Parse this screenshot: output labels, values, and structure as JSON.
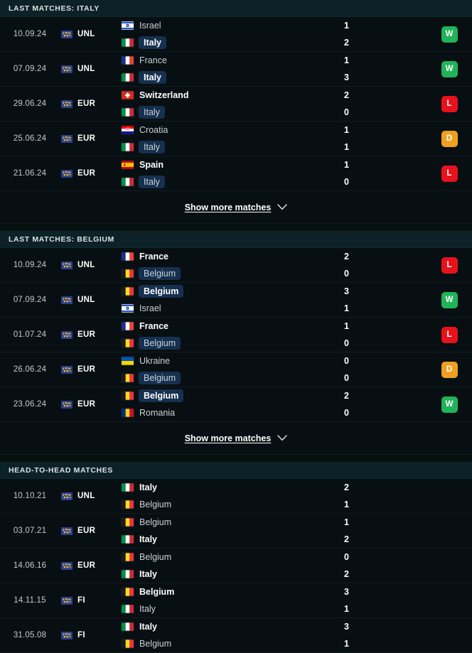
{
  "colors": {
    "page_bg": "#06100f",
    "row_bg": "#080f12",
    "section_header_bg": "#0c2226",
    "highlight_bg": "#16304f",
    "win": "#21b35a",
    "loss": "#e8121c",
    "draw": "#f0a01e",
    "comp_icon_bg": "#2b3f8f",
    "comp_icon_fg": "#e8bb3c"
  },
  "sections": [
    {
      "id": "last-matches-italy",
      "title": "LAST MATCHES: ITALY",
      "has_show_more": true,
      "show_more_label": "Show more matches",
      "show_more_icon": "chevron-down-icon",
      "has_result_badges": true,
      "matches": [
        {
          "date": "10.09.24",
          "competition_code": "UNL",
          "competition_icon": "unl-logo-icon",
          "home_team": "Israel",
          "home_flag": "israel",
          "home_score": "1",
          "home_winner": false,
          "home_highlight": false,
          "away_team": "Italy",
          "away_flag": "italy",
          "away_score": "2",
          "away_winner": true,
          "away_highlight": true,
          "result": "W"
        },
        {
          "date": "07.09.24",
          "competition_code": "UNL",
          "competition_icon": "unl-logo-icon",
          "home_team": "France",
          "home_flag": "france",
          "home_score": "1",
          "home_winner": false,
          "home_highlight": false,
          "away_team": "Italy",
          "away_flag": "italy",
          "away_score": "3",
          "away_winner": true,
          "away_highlight": true,
          "result": "W"
        },
        {
          "date": "29.06.24",
          "competition_code": "EUR",
          "competition_icon": "eur-logo-icon",
          "home_team": "Switzerland",
          "home_flag": "switzerland",
          "home_score": "2",
          "home_winner": true,
          "home_highlight": false,
          "away_team": "Italy",
          "away_flag": "italy",
          "away_score": "0",
          "away_winner": false,
          "away_highlight": true,
          "result": "L"
        },
        {
          "date": "25.06.24",
          "competition_code": "EUR",
          "competition_icon": "eur-logo-icon",
          "home_team": "Croatia",
          "home_flag": "croatia",
          "home_score": "1",
          "home_winner": false,
          "home_highlight": false,
          "away_team": "Italy",
          "away_flag": "italy",
          "away_score": "1",
          "away_winner": false,
          "away_highlight": true,
          "result": "D"
        },
        {
          "date": "21.06.24",
          "competition_code": "EUR",
          "competition_icon": "eur-logo-icon",
          "home_team": "Spain",
          "home_flag": "spain",
          "home_score": "1",
          "home_winner": true,
          "home_highlight": false,
          "away_team": "Italy",
          "away_flag": "italy",
          "away_score": "0",
          "away_winner": false,
          "away_highlight": true,
          "result": "L"
        }
      ]
    },
    {
      "id": "last-matches-belgium",
      "title": "LAST MATCHES: BELGIUM",
      "has_show_more": true,
      "show_more_label": "Show more matches",
      "show_more_icon": "chevron-down-icon",
      "has_result_badges": true,
      "matches": [
        {
          "date": "10.09.24",
          "competition_code": "UNL",
          "competition_icon": "unl-logo-icon",
          "home_team": "France",
          "home_flag": "france",
          "home_score": "2",
          "home_winner": true,
          "home_highlight": false,
          "away_team": "Belgium",
          "away_flag": "belgium",
          "away_score": "0",
          "away_winner": false,
          "away_highlight": true,
          "result": "L"
        },
        {
          "date": "07.09.24",
          "competition_code": "UNL",
          "competition_icon": "unl-logo-icon",
          "home_team": "Belgium",
          "home_flag": "belgium",
          "home_score": "3",
          "home_winner": true,
          "home_highlight": true,
          "away_team": "Israel",
          "away_flag": "israel",
          "away_score": "1",
          "away_winner": false,
          "away_highlight": false,
          "result": "W"
        },
        {
          "date": "01.07.24",
          "competition_code": "EUR",
          "competition_icon": "eur-logo-icon",
          "home_team": "France",
          "home_flag": "france",
          "home_score": "1",
          "home_winner": true,
          "home_highlight": false,
          "away_team": "Belgium",
          "away_flag": "belgium",
          "away_score": "0",
          "away_winner": false,
          "away_highlight": true,
          "result": "L"
        },
        {
          "date": "26.06.24",
          "competition_code": "EUR",
          "competition_icon": "eur-logo-icon",
          "home_team": "Ukraine",
          "home_flag": "ukraine",
          "home_score": "0",
          "home_winner": false,
          "home_highlight": false,
          "away_team": "Belgium",
          "away_flag": "belgium",
          "away_score": "0",
          "away_winner": false,
          "away_highlight": true,
          "result": "D"
        },
        {
          "date": "23.06.24",
          "competition_code": "EUR",
          "competition_icon": "eur-logo-icon",
          "home_team": "Belgium",
          "home_flag": "belgium",
          "home_score": "2",
          "home_winner": true,
          "home_highlight": true,
          "away_team": "Romania",
          "away_flag": "romania",
          "away_score": "0",
          "away_winner": false,
          "away_highlight": false,
          "result": "W"
        }
      ]
    },
    {
      "id": "head-to-head-matches",
      "title": "HEAD-TO-HEAD MATCHES",
      "has_show_more": false,
      "show_more_label": "",
      "show_more_icon": "",
      "has_result_badges": false,
      "matches": [
        {
          "date": "10.10.21",
          "competition_code": "UNL",
          "competition_icon": "unl-logo-icon",
          "home_team": "Italy",
          "home_flag": "italy",
          "home_score": "2",
          "home_winner": true,
          "home_highlight": false,
          "away_team": "Belgium",
          "away_flag": "belgium",
          "away_score": "1",
          "away_winner": false,
          "away_highlight": false,
          "result": ""
        },
        {
          "date": "03.07.21",
          "competition_code": "EUR",
          "competition_icon": "eur-logo-icon",
          "home_team": "Belgium",
          "home_flag": "belgium",
          "home_score": "1",
          "home_winner": false,
          "home_highlight": false,
          "away_team": "Italy",
          "away_flag": "italy",
          "away_score": "2",
          "away_winner": true,
          "away_highlight": false,
          "result": ""
        },
        {
          "date": "14.06.16",
          "competition_code": "EUR",
          "competition_icon": "eur-logo-icon",
          "home_team": "Belgium",
          "home_flag": "belgium",
          "home_score": "0",
          "home_winner": false,
          "home_highlight": false,
          "away_team": "Italy",
          "away_flag": "italy",
          "away_score": "2",
          "away_winner": true,
          "away_highlight": false,
          "result": ""
        },
        {
          "date": "14.11.15",
          "competition_code": "FI",
          "competition_icon": "fi-logo-icon",
          "home_team": "Belgium",
          "home_flag": "belgium",
          "home_score": "3",
          "home_winner": true,
          "home_highlight": false,
          "away_team": "Italy",
          "away_flag": "italy",
          "away_score": "1",
          "away_winner": false,
          "away_highlight": false,
          "result": ""
        },
        {
          "date": "31.05.08",
          "competition_code": "FI",
          "competition_icon": "fi-logo-icon",
          "home_team": "Italy",
          "home_flag": "italy",
          "home_score": "3",
          "home_winner": true,
          "home_highlight": false,
          "away_team": "Belgium",
          "away_flag": "belgium",
          "away_score": "1",
          "away_winner": false,
          "away_highlight": false,
          "result": ""
        }
      ]
    }
  ]
}
